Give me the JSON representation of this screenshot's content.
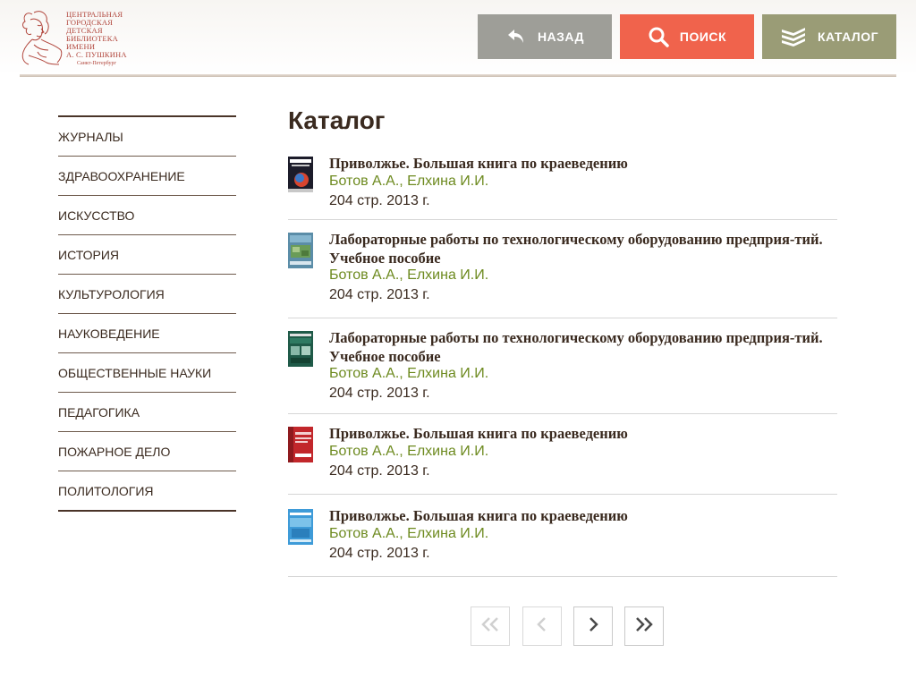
{
  "logo": {
    "lines": [
      "Центральная",
      "городская",
      "детская",
      "библиотека",
      "имени",
      "А. С. Пушкина"
    ],
    "city": "Санкт-Петербург"
  },
  "header": {
    "back_label": "НАЗАД",
    "search_label": "ПОИСК",
    "catalog_label": "КАТАЛОГ"
  },
  "colors": {
    "back": "#9e9e98",
    "search": "#f0634c",
    "catalog": "#9a9c76",
    "author_link": "#6d8a1f",
    "text": "#3a2a1f"
  },
  "sidebar": {
    "items": [
      {
        "label": "Журналы"
      },
      {
        "label": "Здравоохранение"
      },
      {
        "label": "Искусство"
      },
      {
        "label": "История"
      },
      {
        "label": "Культурология"
      },
      {
        "label": "Науковедение"
      },
      {
        "label": "Общественные науки"
      },
      {
        "label": "Педагогика"
      },
      {
        "label": "Пожарное дело"
      },
      {
        "label": "Политология"
      }
    ]
  },
  "main": {
    "title": "Каталог",
    "books": [
      {
        "title": "Приволжье. Большая книга по краеведению",
        "authors": "Ботов А.А., Елхина И.И.",
        "meta": "204 стр. 2013 г."
      },
      {
        "title": "Лабораторные работы по технологическому оборудованию предприя-тий. Учебное пособие",
        "authors": "Ботов А.А., Елхина И.И.",
        "meta": "204 стр. 2013 г."
      },
      {
        "title": "Лабораторные работы по технологическому оборудованию предприя-тий. Учебное пособие",
        "authors": "Ботов А.А., Елхина И.И.",
        "meta": "204 стр. 2013 г."
      },
      {
        "title": "Приволжье. Большая книга по краеведению",
        "authors": "Ботов А.А., Елхина И.И.",
        "meta": "204 стр. 2013 г."
      },
      {
        "title": "Приволжье. Большая книга по краеведению",
        "authors": "Ботов А.А., Елхина И.И.",
        "meta": "204 стр. 2013 г."
      }
    ]
  },
  "pagination": {
    "first_icon": "double-chevron-left-icon",
    "prev_icon": "chevron-left-icon",
    "next_icon": "chevron-right-icon",
    "last_icon": "double-chevron-right-icon"
  }
}
